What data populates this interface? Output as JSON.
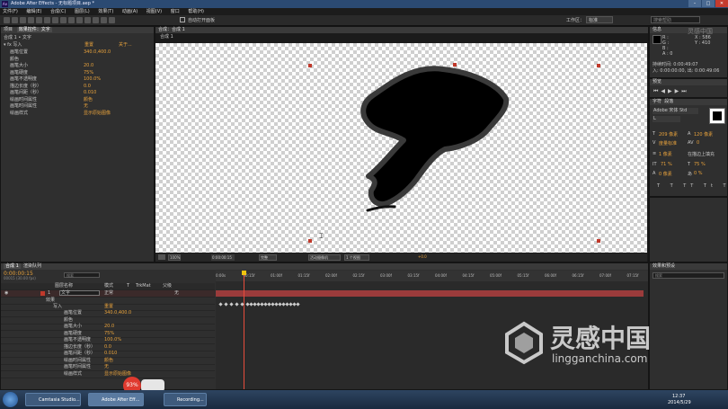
{
  "titlebar": {
    "title": "Adobe After Effects - 无标题项目.aep *"
  },
  "menu": [
    "文件(F)",
    "编辑(E)",
    "合成(C)",
    "图层(L)",
    "效果(T)",
    "动画(A)",
    "视图(V)",
    "窗口",
    "帮助(H)"
  ],
  "toolbar": {
    "auto_open": "自动打开面板",
    "workspace": "工作区：",
    "workspace_value": "标准",
    "search_placeholder": "搜索帮助"
  },
  "effect_panel": {
    "tabs": [
      "项目",
      "效果控件：文字"
    ],
    "breadcrumb": "合成 1 • 文字",
    "fx_name": "写入",
    "reset": "重置",
    "about": "关于...",
    "props": [
      {
        "label": "画笔位置",
        "value": "340.0,400.0"
      },
      {
        "label": "颜色",
        "value": ""
      },
      {
        "label": "画笔大小",
        "value": "20.0"
      },
      {
        "label": "画笔硬度",
        "value": "75%"
      },
      {
        "label": "画笔不透明度",
        "value": "100.0%"
      },
      {
        "label": "描边长度（秒）",
        "value": "0.0"
      },
      {
        "label": "画笔间距（秒）",
        "value": "0.010"
      },
      {
        "label": "绘画时间属性",
        "value": "颜色"
      },
      {
        "label": "画笔时间属性",
        "value": "无"
      },
      {
        "label": "绘画样式",
        "value": "显示原始图像"
      }
    ]
  },
  "comp_panel": {
    "tab": "合成：合成 1",
    "subtab": "合成 1",
    "zoom": "100%",
    "timecode": "0:00:00:15",
    "resolution": "完整",
    "camera": "活动摄像机",
    "views": "1 个视图",
    "exposure": "+0.0"
  },
  "info_panel": {
    "tab": "信息",
    "x": "X : 586",
    "y": "Y : 410",
    "r": "R :",
    "g": "G :",
    "b": "B :",
    "a": "A : 0",
    "line1": "持续时间: 0:00:49:07",
    "line2": "入: 0:00:00:00, 出: 0:00:49:06"
  },
  "preview_panel": {
    "tab": "预览"
  },
  "char_panel": {
    "tabs": [
      "字符",
      "段落"
    ],
    "font": "Adobe 宋体 Std",
    "style": "L",
    "size": "209 像素",
    "leading": "120 像素",
    "kerning": "度量标准",
    "tracking": "0",
    "stroke": "1 像素",
    "stroke_mode": "在描边上填充",
    "vscale": "71 %",
    "hscale": "75 %",
    "baseline": "0 像素",
    "tsume": "0 %"
  },
  "effects_panel": {
    "tab": "效果和预设",
    "search_placeholder": "搜索"
  },
  "timeline": {
    "tabs": [
      "合成 1",
      "渲染队列"
    ],
    "timecode": "0:00:00:15",
    "frames_line": "00015 (30.00 fps)",
    "search_placeholder": "搜索",
    "cols": [
      "图层名称",
      "模式",
      "T",
      "TrkMat",
      "父级"
    ],
    "layer": {
      "num": "1",
      "name": "文字",
      "mode": "正常",
      "parent": "无"
    },
    "effects_label": "效果",
    "fx_name": "写入",
    "reset": "重置",
    "props": [
      {
        "label": "画笔位置",
        "value": "340.0,400.0"
      },
      {
        "label": "颜色",
        "value": ""
      },
      {
        "label": "画笔大小",
        "value": "20.0"
      },
      {
        "label": "画笔硬度",
        "value": "75%"
      },
      {
        "label": "画笔不透明度",
        "value": "100.0%"
      },
      {
        "label": "描边长度（秒）",
        "value": "0.0"
      },
      {
        "label": "画笔间距（秒）",
        "value": "0.010"
      },
      {
        "label": "绘画时间属性",
        "value": "颜色"
      },
      {
        "label": "画笔时间属性",
        "value": "无"
      },
      {
        "label": "绘画样式",
        "value": "显示原始图像"
      }
    ],
    "ruler": [
      "0:00s",
      "00:15f",
      "01:00f",
      "01:15f",
      "02:00f",
      "02:15f",
      "03:00f",
      "03:15f",
      "04:00f",
      "04:15f",
      "05:00f",
      "05:15f",
      "06:00f",
      "06:15f",
      "07:00f",
      "07:15f"
    ]
  },
  "taskbar": {
    "apps": [
      "Camtasia Studio...",
      "Adobe After Eff...",
      "Recording..."
    ],
    "rec_badge": "93%",
    "clock_time": "12:37",
    "clock_date": "2014/5/29"
  },
  "watermark": {
    "brand_cn": "灵感中国",
    "brand_url": "lingganchina.com",
    "corner_cn": "灵感中国"
  }
}
